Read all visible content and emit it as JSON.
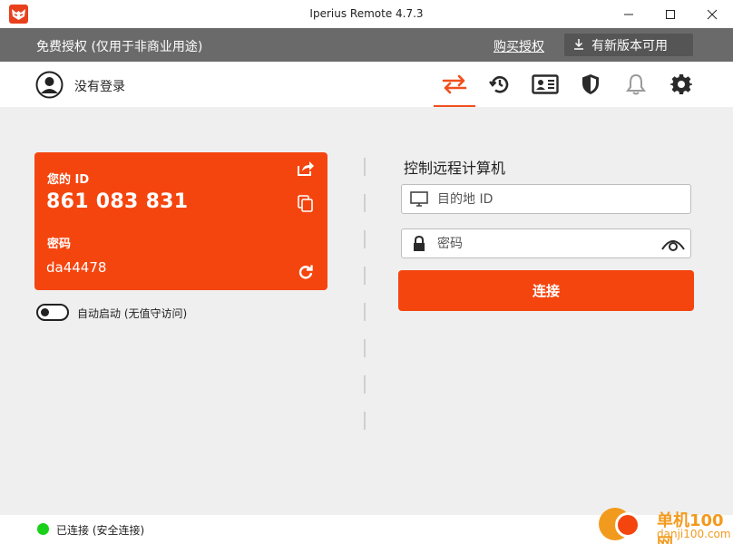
{
  "window": {
    "title": "Iperius Remote 4.7.3"
  },
  "license_bar": {
    "license_text": "免费授权 (仅用于非商业用途)",
    "buy_link": "购买授权",
    "update_button": "有新版本可用"
  },
  "nav": {
    "login_status": "没有登录",
    "icons": [
      "transfer-icon",
      "history-icon",
      "contacts-card-icon",
      "shield-icon",
      "bell-icon",
      "gear-icon"
    ],
    "active": "transfer-icon"
  },
  "id_card": {
    "id_label": "您的 ID",
    "id_value": "861 083 831",
    "password_label": "密码",
    "password_value": "da44478"
  },
  "autostart": {
    "label": "自动启动 (无值守访问)",
    "enabled": false
  },
  "remote": {
    "title": "控制远程计算机",
    "id_placeholder": "目的地 ID",
    "password_placeholder": "密码",
    "connect_button": "连接"
  },
  "status": {
    "text": "已连接 (安全连接)",
    "color": "#19d119"
  },
  "watermark": {
    "title": "单机100网",
    "subtitle": "danji100.com"
  },
  "colors": {
    "accent": "#f5450f",
    "license_bar": "#6a6a6a"
  }
}
